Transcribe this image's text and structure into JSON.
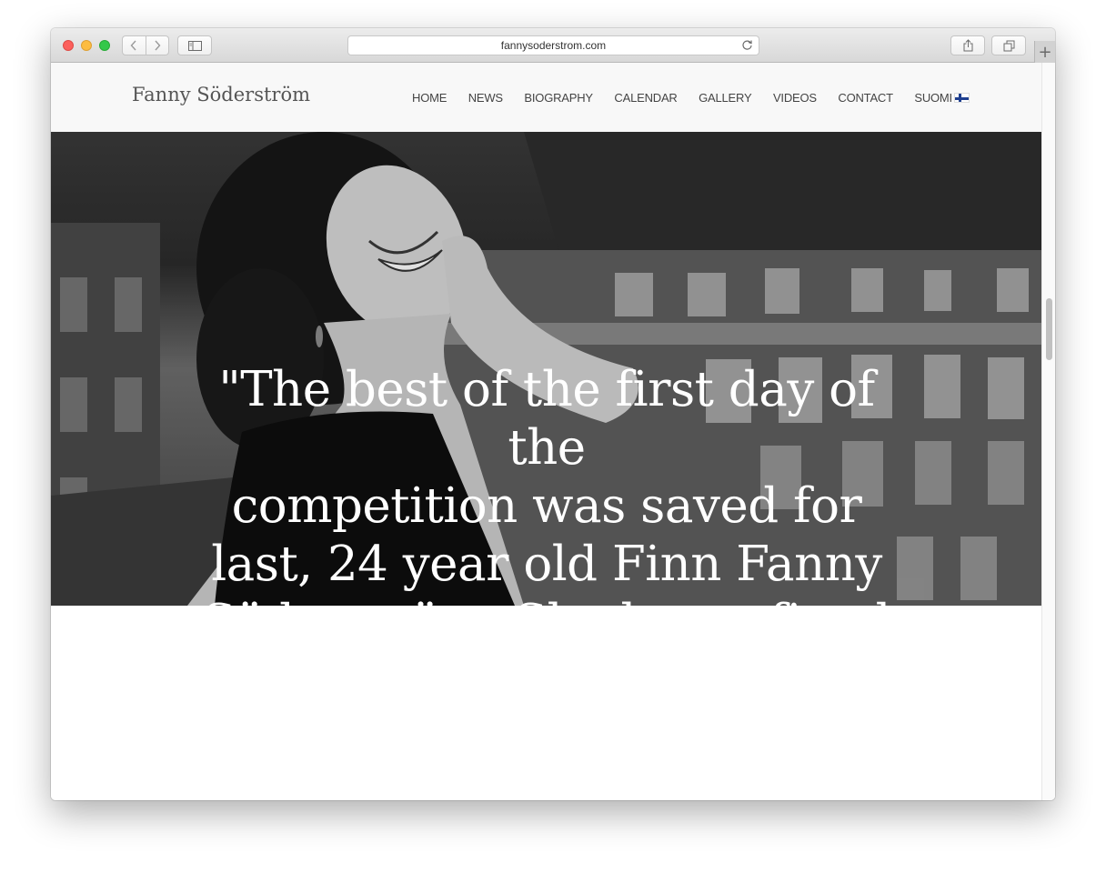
{
  "browser": {
    "url": "fannysoderstrom.com",
    "icons": {
      "back": "chevron-left-icon",
      "forward": "chevron-right-icon",
      "sidebar": "sidebar-icon",
      "reload": "reload-icon",
      "share": "share-icon",
      "tabs": "tabs-overview-icon",
      "new_tab": "plus-icon"
    },
    "new_tab_glyph": "+"
  },
  "site": {
    "title": "Fanny Söderström",
    "nav": [
      {
        "label": "HOME"
      },
      {
        "label": "NEWS"
      },
      {
        "label": "BIOGRAPHY"
      },
      {
        "label": "CALENDAR"
      },
      {
        "label": "GALLERY"
      },
      {
        "label": "VIDEOS"
      },
      {
        "label": "CONTACT"
      },
      {
        "label": "SUOMI"
      }
    ],
    "language_flag": "finland-flag-icon"
  },
  "hero": {
    "quote_lines": [
      "\"The best of the first day of the",
      "competition was saved for",
      "last, 24 year old Finn Fanny",
      "Söderström. She has refined"
    ],
    "image": "black-and-white-portrait-of-smiling-woman-in-front-of-building"
  },
  "colors": {
    "header_bg": "#f8f8f8",
    "nav_text": "#444444",
    "title_text": "#555555",
    "hero_text": "#ffffff"
  }
}
